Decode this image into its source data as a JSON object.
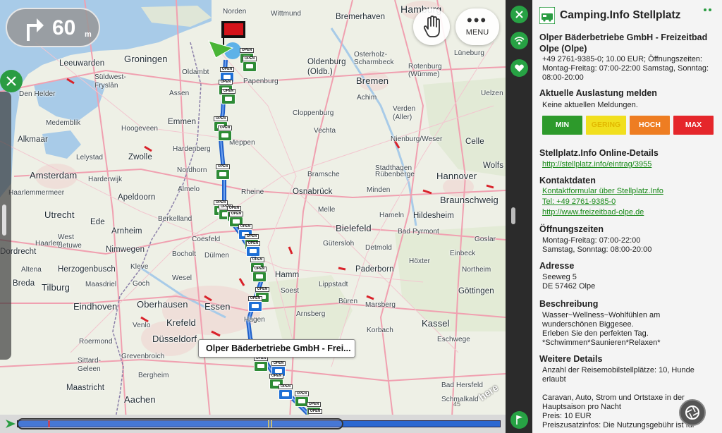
{
  "speed": {
    "value": "60",
    "unit": "m"
  },
  "map_buttons": {
    "menu_label": "MENU"
  },
  "tooltip": "Olper Bäderbetriebe GmbH - Frei...",
  "scale_label": "45",
  "brand": "here",
  "cities": [
    {
      "name": "Hamburg",
      "size": "xl"
    },
    {
      "name": "Norden",
      "size": "s"
    },
    {
      "name": "Wittmund",
      "size": "s"
    },
    {
      "name": "Bremerhaven",
      "size": "m"
    },
    {
      "name": "Groningen",
      "size": "l"
    },
    {
      "name": "Leeuwarden",
      "size": "m"
    },
    {
      "name": "Oldenburg",
      "size": "m"
    },
    {
      "name": "(Oldb.)",
      "size": "m"
    },
    {
      "name": "Osterholz-",
      "size": "s"
    },
    {
      "name": "Scharmbeck",
      "size": "s"
    },
    {
      "name": "Lüneburg",
      "size": "s"
    },
    {
      "name": "Süldwest-",
      "size": "s"
    },
    {
      "name": "Fryslân",
      "size": "s"
    },
    {
      "name": "Oldambt",
      "size": "s"
    },
    {
      "name": "Bremen",
      "size": "l"
    },
    {
      "name": "Rotenburg",
      "size": "s"
    },
    {
      "name": "(Wümme)",
      "size": "s"
    },
    {
      "name": "Den Helder",
      "size": "s"
    },
    {
      "name": "Assen",
      "size": "s"
    },
    {
      "name": "Papenburg",
      "size": "s"
    },
    {
      "name": "Achim",
      "size": "s"
    },
    {
      "name": "Uelzen",
      "size": "s"
    },
    {
      "name": "Medemblik",
      "size": "s"
    },
    {
      "name": "Cloppenburg",
      "size": "s"
    },
    {
      "name": "Verden",
      "size": "s"
    },
    {
      "name": "(Aller)",
      "size": "s"
    },
    {
      "name": "Emmen",
      "size": "m"
    },
    {
      "name": "Hoogeveen",
      "size": "s"
    },
    {
      "name": "Vechta",
      "size": "s"
    },
    {
      "name": "Alkmaar",
      "size": "m"
    },
    {
      "name": "Lelystad",
      "size": "s"
    },
    {
      "name": "Nienburg/Weser",
      "size": "s"
    },
    {
      "name": "Celle",
      "size": "m"
    },
    {
      "name": "Zwolle",
      "size": "m"
    },
    {
      "name": "Meppen",
      "size": "s"
    },
    {
      "name": "Hardenberg",
      "size": "s"
    },
    {
      "name": "Amsterdam",
      "size": "l"
    },
    {
      "name": "Nordhorn",
      "size": "s"
    },
    {
      "name": "Bramsche",
      "size": "s"
    },
    {
      "name": "Stadthagen",
      "size": "s"
    },
    {
      "name": "Rübenberge",
      "size": "s"
    },
    {
      "name": "Hannover",
      "size": "l"
    },
    {
      "name": "Wolfs",
      "size": "m"
    },
    {
      "name": "Haarlemmermeer",
      "size": "s"
    },
    {
      "name": "Harderwijk",
      "size": "s"
    },
    {
      "name": "Almelo",
      "size": "s"
    },
    {
      "name": "Rheine",
      "size": "s"
    },
    {
      "name": "Osnabrück",
      "size": "m"
    },
    {
      "name": "Minden",
      "size": "s"
    },
    {
      "name": "Braunschweig",
      "size": "l"
    },
    {
      "name": "Apeldoorn",
      "size": "m"
    },
    {
      "name": "Utrecht",
      "size": "l"
    },
    {
      "name": "Berkelland",
      "size": "s"
    },
    {
      "name": "Melle",
      "size": "s"
    },
    {
      "name": "Hildesheim",
      "size": "m"
    },
    {
      "name": "Ede",
      "size": "m"
    },
    {
      "name": "Bielefeld",
      "size": "l"
    },
    {
      "name": "Hameln",
      "size": "s"
    },
    {
      "name": "Arnheim",
      "size": "m"
    },
    {
      "name": "Bad Pyrmont",
      "size": "s"
    },
    {
      "name": "Coesfeld",
      "size": "s"
    },
    {
      "name": "West",
      "size": "s"
    },
    {
      "name": "Betuwe",
      "size": "s"
    },
    {
      "name": "Gütersloh",
      "size": "s"
    },
    {
      "name": "Goslar",
      "size": "s"
    },
    {
      "name": "Nimwegen",
      "size": "m"
    },
    {
      "name": "Detmold",
      "size": "s"
    },
    {
      "name": "Dordrecht",
      "size": "m"
    },
    {
      "name": "Bocholt",
      "size": "s"
    },
    {
      "name": "Dülmen",
      "size": "s"
    },
    {
      "name": "Einbeck",
      "size": "s"
    },
    {
      "name": "Kleve",
      "size": "s"
    },
    {
      "name": "Höxter",
      "size": "s"
    },
    {
      "name": "Altena",
      "size": "s"
    },
    {
      "name": "Herzogenbusch",
      "size": "m"
    },
    {
      "name": "Hamm",
      "size": "m"
    },
    {
      "name": "Paderborn",
      "size": "m"
    },
    {
      "name": "Northeim",
      "size": "s"
    },
    {
      "name": "Breda",
      "size": "m"
    },
    {
      "name": "Tilburg",
      "size": "l"
    },
    {
      "name": "Maasdriel",
      "size": "s"
    },
    {
      "name": "Wesel",
      "size": "s"
    },
    {
      "name": "Goch",
      "size": "s"
    },
    {
      "name": "Lippstadt",
      "size": "s"
    },
    {
      "name": "Soest",
      "size": "s"
    },
    {
      "name": "Göttingen",
      "size": "m"
    },
    {
      "name": "Eindhoven",
      "size": "l"
    },
    {
      "name": "Oberhausen",
      "size": "l"
    },
    {
      "name": "Essen",
      "size": "l"
    },
    {
      "name": "Büren",
      "size": "s"
    },
    {
      "name": "Marsberg",
      "size": "s"
    },
    {
      "name": "Arnsberg",
      "size": "s"
    },
    {
      "name": "Hagen",
      "size": "s"
    },
    {
      "name": "Venlo",
      "size": "s"
    },
    {
      "name": "Krefeld",
      "size": "l"
    },
    {
      "name": "Kassel",
      "size": "l"
    },
    {
      "name": "Korbach",
      "size": "s"
    },
    {
      "name": "Roermond",
      "size": "s"
    },
    {
      "name": "Düsseldorf",
      "size": "l"
    },
    {
      "name": "Eschwege",
      "size": "s"
    },
    {
      "name": "Sittard-",
      "size": "s"
    },
    {
      "name": "Geleen",
      "size": "s"
    },
    {
      "name": "Grevenbroich",
      "size": "s"
    },
    {
      "name": "Bergheim",
      "size": "s"
    },
    {
      "name": "Bad Hersfeld",
      "size": "s"
    },
    {
      "name": "Maastricht",
      "size": "m"
    },
    {
      "name": "Schmalkald",
      "size": "s"
    },
    {
      "name": "Aachen",
      "size": "l"
    },
    {
      "name": "Haarlem",
      "size": "s"
    }
  ],
  "panel": {
    "title": "Camping.Info Stellplatz",
    "place_name": "Olper Bäderbetriebe GmbH - Freizeitbad Olpe (Olpe)",
    "meta": "+49 2761-9385-0; 10.00 EUR; Öffnungszeiten: Montag-Freitag: 07:00-22:00 Samstag, Sonntag: 08:00-20:00",
    "occupancy_heading": "Aktuelle Auslastung melden",
    "occupancy_none": "Keine aktuellen Meldungen.",
    "occupancy_buttons": [
      "MIN",
      "GERING",
      "HOCH",
      "MAX"
    ],
    "details_heading": "Stellplatz.Info Online-Details",
    "details_link": "http://stellplatz.info/eintrag/3955",
    "contact_heading": "Kontaktdaten",
    "contact_links": [
      "Kontaktformular über Stellplatz.Info",
      "Tel: +49 2761-9385-0",
      "http://www.freizeitbad-olpe.de"
    ],
    "hours_heading": "Öffnungszeiten",
    "hours_lines": [
      "Montag-Freitag: 07:00-22:00",
      "Samstag, Sonntag: 08:00-20:00"
    ],
    "address_heading": "Adresse",
    "address_lines": [
      "Seeweg 5",
      "DE 57462 Olpe"
    ],
    "desc_heading": "Beschreibung",
    "desc_lines": [
      "Wasser~Wellness~Wohlfühlen am",
      "wunderschönen Biggesee.",
      "Erleben Sie den perfekten Tag.",
      "*Schwimmen*Saunieren*Relaxen*"
    ],
    "more_heading": "Weitere Details",
    "more_lines": [
      "Anzahl der Reisemobilstellplätze: 10, Hunde",
      "erlaubt",
      "",
      "Caravan, Auto, Strom und Ortstaxe in der",
      "Hauptsaison pro Nacht",
      "Preis: 10 EUR",
      "Preiszusatzinfos: Die Nutzungsgebühr ist für"
    ]
  },
  "poi_tag": "OPEN",
  "colors": {
    "accent_green": "#2a9c42",
    "route_blue": "#2b67d1",
    "link_green": "#1a8a1a"
  }
}
